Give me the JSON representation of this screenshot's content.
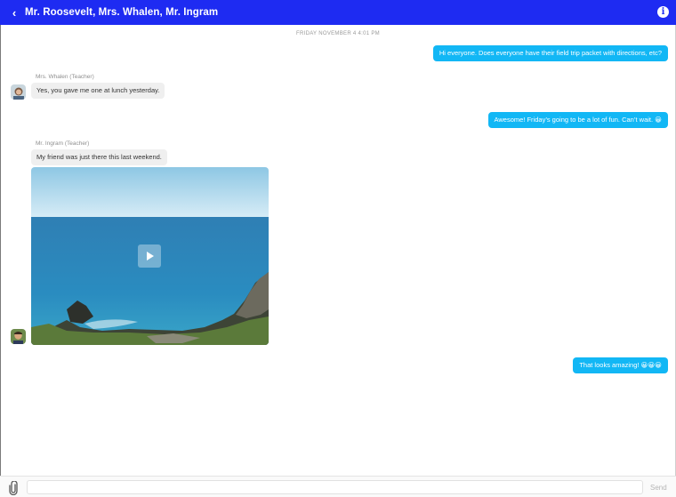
{
  "header": {
    "back_icon": "‹",
    "title": "Mr. Roosevelt, Mrs. Whalen, Mr. Ingram",
    "info_icon": "i",
    "color": "#1e2bf2"
  },
  "thread": {
    "datestamp": "FRIDAY NOVEMBER 4 4:01 PM",
    "messages": [
      {
        "direction": "outgoing",
        "text": "Hi everyone. Does everyone have their field trip packet with directions, etc?"
      },
      {
        "direction": "incoming",
        "sender": "Mrs. Whalen (Teacher)",
        "text": "Yes, you gave me one at lunch yesterday.",
        "avatar": "whalen-avatar"
      },
      {
        "direction": "outgoing",
        "text": "Awesome! Friday’s going to be a lot of fun. Can’t wait. 😀"
      },
      {
        "direction": "incoming",
        "sender": "Mr. Ingram (Teacher)",
        "text": "My friend was just there this last weekend.",
        "avatar": "ingram-avatar",
        "attachment": "video"
      },
      {
        "direction": "outgoing",
        "text": "That looks amazing! 😀😀😀"
      }
    ]
  },
  "composer": {
    "attach_icon": "paperclip-icon",
    "placeholder": "",
    "value": "",
    "send_label": "Send"
  },
  "colors": {
    "outgoing_bubble": "#12b7f5",
    "incoming_bubble": "#efefef"
  }
}
